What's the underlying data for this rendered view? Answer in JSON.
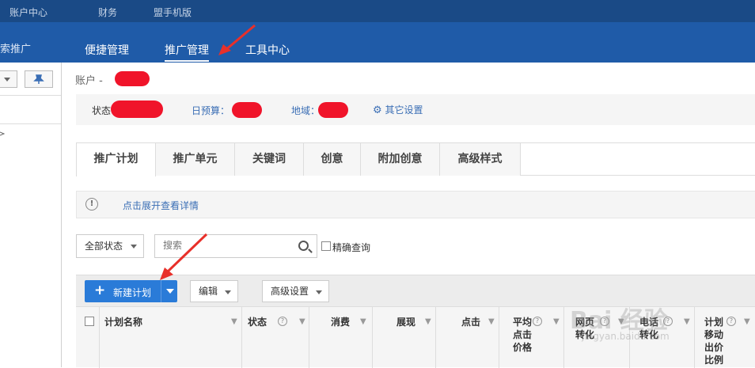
{
  "topbar": {
    "items": [
      "账户中心",
      "财务",
      "  盟手机版"
    ]
  },
  "navbar": {
    "brand": "索推广",
    "tabs": [
      "便捷管理",
      "推广管理",
      "工具中心"
    ],
    "active_tab": "推广管理"
  },
  "account": {
    "label": "账户 -"
  },
  "info": {
    "status_label": "状态",
    "budget_label": "日预算：",
    "region_label": "地域：",
    "other_settings": "其它设置"
  },
  "tabs": [
    "推广计划",
    "推广单元",
    "关键词",
    "创意",
    "附加创意",
    "高级样式"
  ],
  "notice": {
    "text": "点击展开查看详情"
  },
  "filter": {
    "status_select": "全部状态",
    "search_placeholder": "搜索",
    "exact_query": "精确查询"
  },
  "toolbar": {
    "new_plan": "新建计划",
    "edit": "编辑",
    "advanced": "高级设置"
  },
  "table": {
    "columns": [
      "计划名称",
      "状态",
      "消费",
      "展现",
      "点击",
      "平均\n点击\n价格",
      "网页\n转化",
      "电话\n转化",
      "计划\n移动\n出价\n比例"
    ]
  },
  "watermark": {
    "main": "Bai 经验",
    "sub": "jingyan.baidu.com"
  },
  "colors": {
    "topbar": "#1a4a86",
    "navbar": "#1f5ba8",
    "primary_button": "#2a7bd8",
    "link": "#3a6eb5",
    "redaction": "#f0142a",
    "annotation_arrow": "#e8302a"
  }
}
